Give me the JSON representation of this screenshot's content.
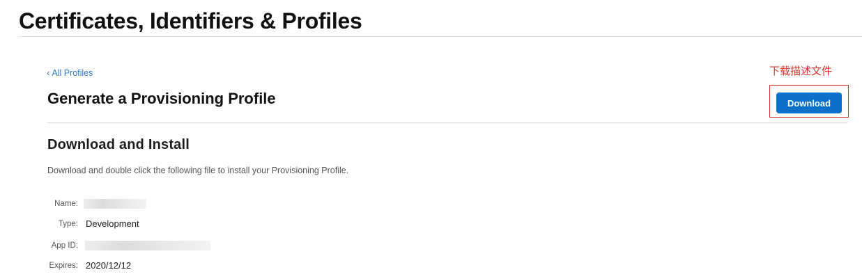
{
  "header": {
    "title": "Certificates, Identifiers & Profiles"
  },
  "nav": {
    "back_chevron": "‹",
    "back_label": "All Profiles"
  },
  "main": {
    "title": "Generate a Provisioning Profile",
    "download_label": "Download",
    "annotation": "下载描述文件",
    "annotation_color": "#d8322a",
    "button_color": "#0b70c9"
  },
  "install": {
    "title": "Download and Install",
    "instructions": "Download and double click the following file to install your Provisioning Profile."
  },
  "details": {
    "name_label": "Name:",
    "type_label": "Type:",
    "type_value": "Development",
    "appid_label": "App ID:",
    "expires_label": "Expires:",
    "expires_value": "2020/12/12"
  }
}
